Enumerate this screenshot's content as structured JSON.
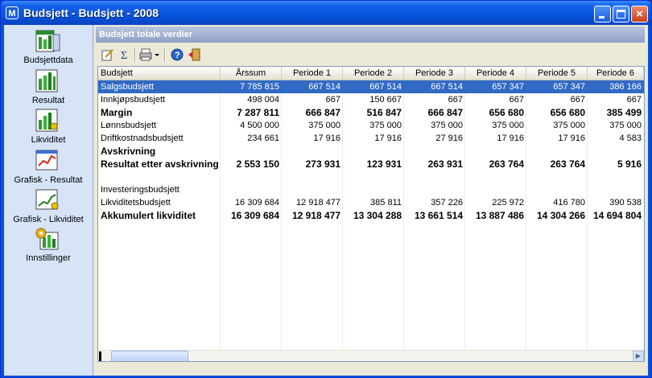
{
  "window": {
    "title": "Budsjett - Budsjett - 2008",
    "app_icon_letter": "M"
  },
  "sidebar": {
    "items": [
      {
        "label": "Budsjettdata",
        "icon": "budget-data-icon"
      },
      {
        "label": "Resultat",
        "icon": "result-chart-icon"
      },
      {
        "label": "Likviditet",
        "icon": "liquidity-chart-icon"
      },
      {
        "label": "Grafisk - Resultat",
        "icon": "graph-result-icon"
      },
      {
        "label": "Grafisk - Likviditet",
        "icon": "graph-liquidity-icon"
      },
      {
        "label": "Innstillinger",
        "icon": "settings-icon"
      }
    ]
  },
  "panel": {
    "title": "Budsjett totale verdier"
  },
  "toolbar": {
    "tools": [
      "edit-icon",
      "sum-icon",
      "print-icon",
      "dropdown-arrow-icon",
      "help-icon",
      "exit-icon"
    ]
  },
  "table": {
    "columns": [
      "Budsjett",
      "Årssum",
      "Periode 1",
      "Periode 2",
      "Periode 3",
      "Periode 4",
      "Periode 5",
      "Periode 6"
    ],
    "rows": [
      {
        "cells": [
          "Salgsbudsjett",
          "7 785 815",
          "667 514",
          "667 514",
          "667 514",
          "657 347",
          "657 347",
          "386 166"
        ],
        "bold": false,
        "selected": true
      },
      {
        "cells": [
          "Innkjøpsbudsjett",
          "498 004",
          "667",
          "150 667",
          "667",
          "667",
          "667",
          "667"
        ],
        "bold": false,
        "selected": false
      },
      {
        "cells": [
          "Margin",
          "7 287 811",
          "666 847",
          "516 847",
          "666 847",
          "656 680",
          "656 680",
          "385 499"
        ],
        "bold": true,
        "selected": false
      },
      {
        "cells": [
          "Lønnsbudsjett",
          "4 500 000",
          "375 000",
          "375 000",
          "375 000",
          "375 000",
          "375 000",
          "375 000"
        ],
        "bold": false,
        "selected": false
      },
      {
        "cells": [
          "Driftkostnadsbudsjett",
          "234 661",
          "17 916",
          "17 916",
          "27 916",
          "17 916",
          "17 916",
          "4 583"
        ],
        "bold": false,
        "selected": false
      },
      {
        "cells": [
          "Avskrivning",
          "",
          "",
          "",
          "",
          "",
          "",
          ""
        ],
        "bold": true,
        "selected": false
      },
      {
        "cells": [
          "Resultat etter avskrivning",
          "2 553 150",
          "273 931",
          "123 931",
          "263 931",
          "263 764",
          "263 764",
          "5 916"
        ],
        "bold": true,
        "selected": false
      },
      {
        "cells": [
          "",
          "",
          "",
          "",
          "",
          "",
          "",
          ""
        ],
        "bold": false,
        "selected": false
      },
      {
        "cells": [
          "Investeringsbudsjett",
          "",
          "",
          "",
          "",
          "",
          "",
          ""
        ],
        "bold": false,
        "selected": false
      },
      {
        "cells": [
          "Likviditetsbudsjett",
          "16 309 684",
          "12 918 477",
          "385 811",
          "357 226",
          "225 972",
          "416 780",
          "390 538"
        ],
        "bold": false,
        "selected": false
      },
      {
        "cells": [
          "Akkumulert likviditet",
          "16 309 684",
          "12 918 477",
          "13 304 288",
          "13 661 514",
          "13 887 486",
          "14 304 266",
          "14 694 804"
        ],
        "bold": true,
        "selected": false
      }
    ]
  },
  "colors": {
    "selection": "#316ac5",
    "title_bar": "#0855dd",
    "sidebar": "#d7e4f7"
  }
}
